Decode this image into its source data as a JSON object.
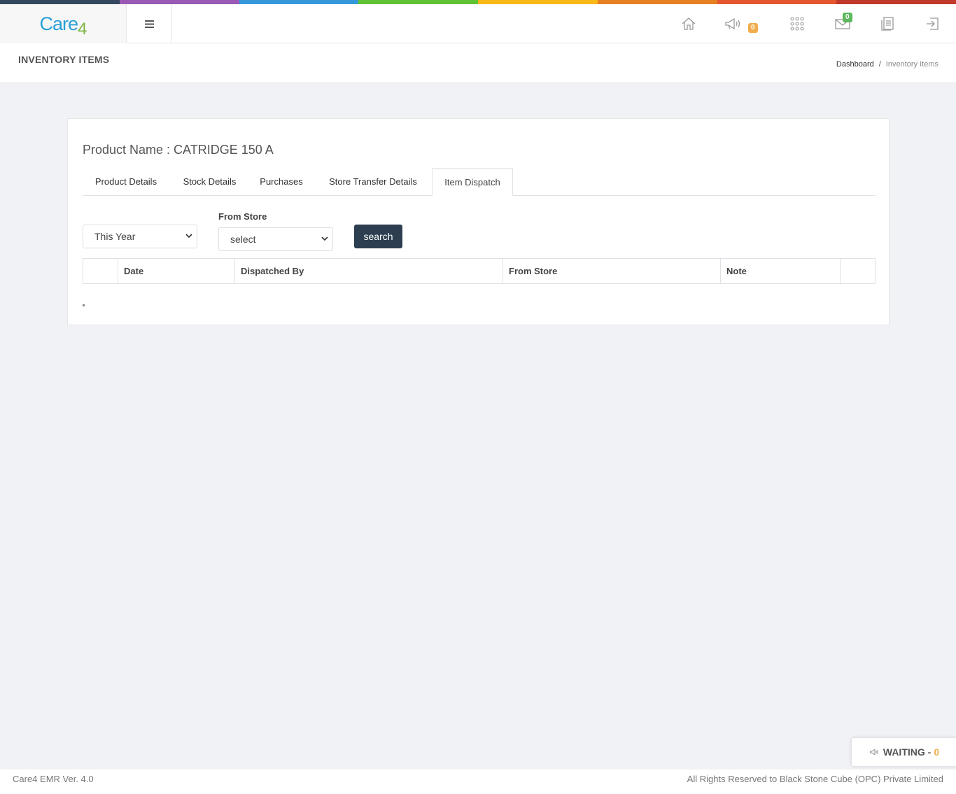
{
  "colors": {
    "topbar_segments": [
      "#34495e",
      "#9b59b6",
      "#3498db",
      "#2ecc40",
      "#f1c40f",
      "#e67e22",
      "#e74c3c",
      "#c0392b"
    ],
    "primary_button": "#2c3e50",
    "badge_orange": "#f0ad4e",
    "badge_green": "#5cb85c"
  },
  "brand": {
    "name": "Care",
    "suffix": "4"
  },
  "topbar": {
    "icons": [
      "home-icon",
      "megaphone-icon",
      "grid-icon",
      "mail-icon",
      "document-icon",
      "logout-icon"
    ],
    "announcements_count": "0",
    "messages_count": "0"
  },
  "header": {
    "title": "INVENTORY ITEMS",
    "breadcrumb": {
      "home": "Dashboard",
      "separator": "/",
      "current": "Inventory Items"
    }
  },
  "product": {
    "name_text": "Product Name : CATRIDGE 150 A"
  },
  "tabs": [
    {
      "label": "Product Details",
      "active": false
    },
    {
      "label": "Stock Details",
      "active": false
    },
    {
      "label": "Purchases",
      "active": false
    },
    {
      "label": "Store Transfer Details",
      "active": false
    },
    {
      "label": "Item Dispatch",
      "active": true
    }
  ],
  "filters": {
    "period_value": "This Year",
    "from_store_label": "From Store",
    "from_store_value": "select",
    "search_label": "search"
  },
  "table": {
    "columns": [
      "",
      "Date",
      "Dispatched By",
      "From Store",
      "Note",
      ""
    ],
    "rows": []
  },
  "waiting": {
    "label": "WAITING -",
    "count": "0"
  },
  "footer": {
    "version": "Care4 EMR Ver. 4.0",
    "rights": "All Rights Reserved to Black Stone Cube (OPC) Private Limited"
  }
}
